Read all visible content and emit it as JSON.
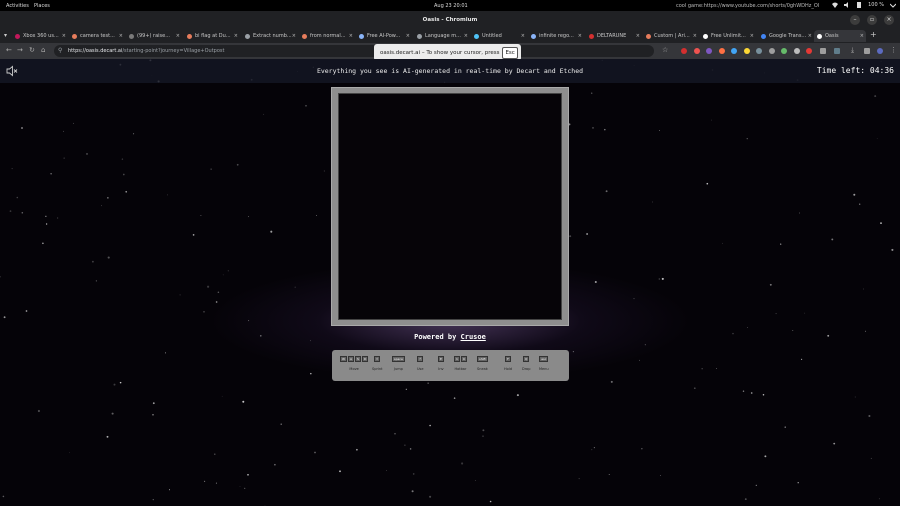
{
  "system": {
    "activities": "Activities",
    "places": "Places",
    "datetime": "Aug 23  20:01",
    "notification": "cool game:https://www.youtube.com/shorts/0ghWDHz_OI",
    "battery": "100 %"
  },
  "window": {
    "title": "Oasis - Chromium"
  },
  "tabs": [
    {
      "label": "Xbox 360 us...",
      "color": "#c2185b"
    },
    {
      "label": "camera test...",
      "color": "#e67c5c"
    },
    {
      "label": "(99+) raise...",
      "color": "#7a7a7a"
    },
    {
      "label": "bi flag at Du...",
      "color": "#e67c5c"
    },
    {
      "label": "Extract numb...",
      "color": "#9aa0a6"
    },
    {
      "label": "from normal...",
      "color": "#e67c5c"
    },
    {
      "label": "Free AI-Pow...",
      "color": "#8ab4f8"
    },
    {
      "label": "Language m...",
      "color": "#9aa0a6"
    },
    {
      "label": "Untitled",
      "color": "#4fc3f7"
    },
    {
      "label": "infinite rego...",
      "color": "#8ab4f8"
    },
    {
      "label": "DELTARUNE",
      "color": "#d32f2f"
    },
    {
      "label": "Custom | Ari...",
      "color": "#e67c5c"
    },
    {
      "label": "Free Unlimit...",
      "color": "#ffffff"
    },
    {
      "label": "Google Trans...",
      "color": "#4285f4"
    },
    {
      "label": "Oasis",
      "color": "#ffffff",
      "active": true
    }
  ],
  "toolbar": {
    "url_host": "https://oasis.decart.ai",
    "url_path": "/starting-point?journey=Village+Outpost"
  },
  "toast": {
    "text": "oasis.decart.ai – To show your cursor, press",
    "key": "Esc"
  },
  "page": {
    "banner": "Everything you see is AI-generated in real-time by Decart and Etched",
    "timer_label": "Time left:",
    "timer_value": "04:36",
    "powered_by": "Powered by",
    "powered_link": "Crusoe"
  },
  "controls": [
    {
      "keys": [
        "W",
        "A",
        "S",
        "D"
      ],
      "label": "Move"
    },
    {
      "keys": [
        "⇧"
      ],
      "label": "Sprint"
    },
    {
      "keys": [
        "space"
      ],
      "label": "Jump"
    },
    {
      "keys": [
        "🖱"
      ],
      "label": "Use"
    },
    {
      "keys": [
        "E"
      ],
      "label": "Inv"
    },
    {
      "keys": [
        "1",
        "9"
      ],
      "label": "Hotbar"
    },
    {
      "keys": [
        "shift"
      ],
      "label": "Sneak"
    },
    {
      "keys": [
        "F"
      ],
      "label": "Hold"
    },
    {
      "keys": [
        "Q"
      ],
      "label": "Drop"
    },
    {
      "keys": [
        "esc"
      ],
      "label": "Menu"
    }
  ]
}
